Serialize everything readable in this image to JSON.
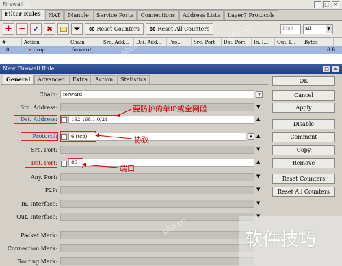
{
  "window": {
    "title": "Firewall"
  },
  "tabs": [
    "Filter Rules",
    "NAT",
    "Mangle",
    "Service Ports",
    "Connections",
    "Address Lists",
    "Layer7 Protocols"
  ],
  "toolbar": {
    "reset_counters": "Reset Counters",
    "reset_all_counters": "Reset All Counters",
    "counter_icon": "00",
    "find_placeholder": "Find",
    "filter_value": "all"
  },
  "grid": {
    "columns": [
      "#",
      "Action",
      "Chain",
      "Src. Add...",
      "Dst. Add...",
      "Pro...",
      "Src. Port",
      "Dst. Port",
      "In. I...",
      "Out. I...",
      "Bytes"
    ],
    "rows": [
      {
        "num": "0",
        "action": "drop",
        "chain": "forward",
        "bytes": "0 B"
      }
    ]
  },
  "dialog": {
    "title": "New Firewall Rule",
    "tabs": [
      "General",
      "Advanced",
      "Extra",
      "Action",
      "Statistics"
    ],
    "fields": {
      "chain": {
        "label": "Chain:",
        "value": "forward"
      },
      "src_address": {
        "label": "Src. Address:"
      },
      "dst_address": {
        "label": "Dst. Address:",
        "value": "192.168.1.0/24"
      },
      "protocol": {
        "label": "Protocol:",
        "value": "6 (tcp)"
      },
      "src_port": {
        "label": "Src. Port:"
      },
      "dst_port": {
        "label": "Dst. Port:",
        "value": "80"
      },
      "any_port": {
        "label": "Any. Port:"
      },
      "p2p": {
        "label": "P2P:"
      },
      "in_interface": {
        "label": "In. Interface:"
      },
      "out_interface": {
        "label": "Out. Interface:"
      },
      "packet_mark": {
        "label": "Packet Mark:"
      },
      "connection_mark": {
        "label": "Connection Mark:"
      },
      "routing_mark": {
        "label": "Routing Mark:"
      }
    },
    "buttons": [
      "OK",
      "Cancel",
      "Apply",
      "Disable",
      "Comment",
      "Copy",
      "Remove",
      "Reset Counters",
      "Reset All Counters"
    ]
  },
  "annotations": {
    "dst_address": "要防护的单IP或全网段",
    "protocol": "协议",
    "dst_port": "端口"
  },
  "watermark": {
    "text": "软件技巧",
    "site": "php.cn"
  },
  "colors": {
    "selected_row": "#9fb6de",
    "dialog_title": "#1f3f86",
    "annotation": "#d20000",
    "remove_icon": "#d00000"
  }
}
